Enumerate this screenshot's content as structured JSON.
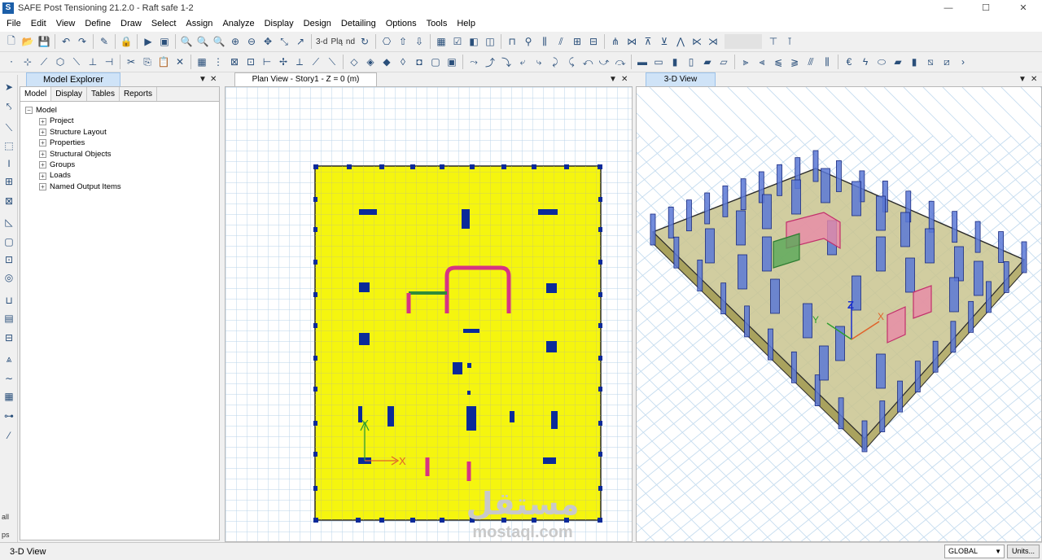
{
  "app": {
    "logo_letter": "S",
    "title": "SAFE Post Tensioning 21.2.0 - Raft safe 1-2"
  },
  "window_controls": {
    "minimize": "—",
    "maximize": "☐",
    "close": "✕"
  },
  "menu": [
    "File",
    "Edit",
    "View",
    "Define",
    "Draw",
    "Select",
    "Assign",
    "Analyze",
    "Display",
    "Design",
    "Detailing",
    "Options",
    "Tools",
    "Help"
  ],
  "toolbar1": {
    "view_3d_label": "3-d",
    "plan_label": "Plą",
    "elevation_label": "nd"
  },
  "panels": {
    "explorer_title": "Model Explorer",
    "plan_title": "Plan View - Story1 - Z = 0 (m)",
    "view3d_title": "3-D View",
    "dropdown_icon": "▼",
    "close_icon": "✕"
  },
  "explorer": {
    "tabs": [
      "Model",
      "Display",
      "Tables",
      "Reports"
    ],
    "root": "Model",
    "items": [
      "Project",
      "Structure Layout",
      "Properties",
      "Structural Objects",
      "Groups",
      "Loads",
      "Named Output Items"
    ],
    "expand_root": "−",
    "expand_child": "+"
  },
  "plan_axes": {
    "x": "X",
    "y": "Y"
  },
  "view3d_axes": {
    "x": "X",
    "y": "Y",
    "z": "Z"
  },
  "lefttools": {
    "all_label": "all",
    "ps_label": "ps"
  },
  "statusbar": {
    "view_name": "3-D View",
    "coord_system": "GLOBAL",
    "units_label": "Units..."
  },
  "watermark": {
    "logo": "مستقل",
    "url": "mostaql.com"
  },
  "colors": {
    "slab": "#f5f50f",
    "slab_outline": "#2a2a2a",
    "column": "#0a2a9a",
    "wall_pink": "#d63384",
    "wall_green": "#2e8b3a",
    "grid": "#b9d3ea",
    "raft_3d": "#c9c48f"
  }
}
